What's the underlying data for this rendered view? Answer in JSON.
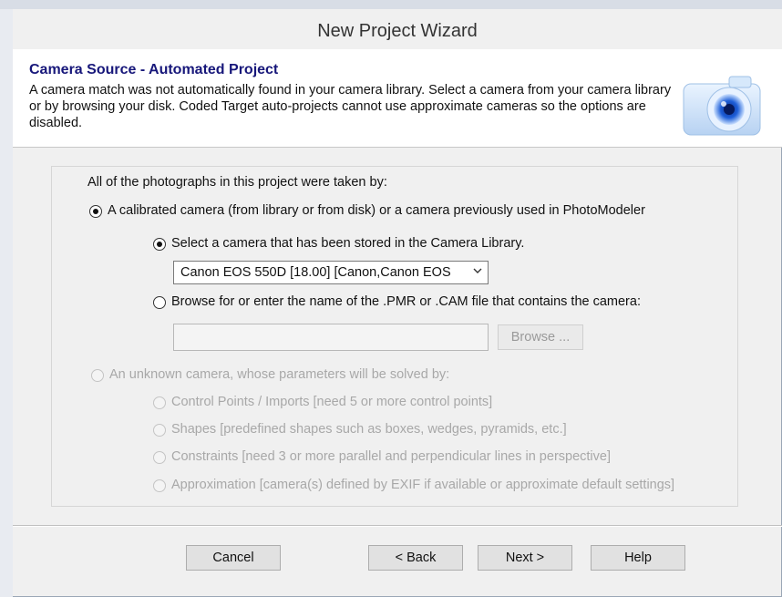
{
  "window": {
    "title": "New Project Wizard"
  },
  "header": {
    "title": "Camera Source - Automated Project",
    "description": "A camera match was not automatically found in your camera library. Select a camera from your camera library or by browsing your disk. Coded Target auto-projects cannot use approximate cameras so the options are disabled.",
    "icon": "camera-icon"
  },
  "group": {
    "intro": "All of the photographs in this project were taken by:",
    "calibrated_option": "A calibrated camera (from library or from disk) or a camera previously used in PhotoModeler",
    "library_option": "Select a camera that has been stored in the Camera Library.",
    "camera_select_value": "Canon EOS 550D [18.00] [Canon,Canon EOS",
    "browse_option": "Browse for or enter the name of the .PMR or .CAM file that contains the camera:",
    "browse_path_value": "",
    "browse_button": "Browse ...",
    "unknown_option": "An unknown camera, whose parameters will be solved by:",
    "sub_options": [
      "Control Points / Imports [need 5 or more control points]",
      "Shapes [predefined shapes such as boxes, wedges, pyramids, etc.]",
      "Constraints [need 3 or more parallel and perpendicular lines in perspective]",
      "Approximation [camera(s) defined by EXIF if available or approximate default settings]"
    ]
  },
  "footer": {
    "cancel": "Cancel",
    "back": "< Back",
    "next": "Next >",
    "help": "Help"
  }
}
